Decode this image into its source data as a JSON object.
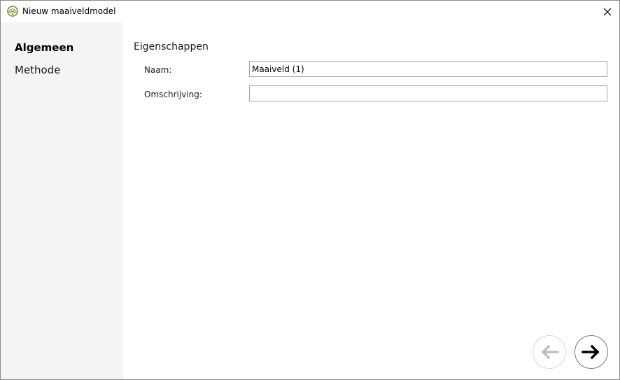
{
  "window": {
    "title": "Nieuw maaiveldmodel"
  },
  "sidebar": {
    "items": [
      {
        "label": "Algemeen",
        "active": true
      },
      {
        "label": "Methode",
        "active": false
      }
    ]
  },
  "main": {
    "section_title": "Eigenschappen",
    "fields": [
      {
        "label": "Naam:",
        "value": "Maaiveld (1)",
        "placeholder": ""
      },
      {
        "label": "Omschrijving:",
        "value": "",
        "placeholder": ""
      }
    ]
  },
  "navigation": {
    "back_icon": "arrow-left-icon",
    "next_icon": "arrow-right-icon",
    "back_enabled": false,
    "next_enabled": true
  },
  "icons": {
    "app": "app-logo-icon",
    "close": "close-icon"
  },
  "colors": {
    "sidebar_bg": "#f4f4f4",
    "accent_green": "#7a9a3a",
    "disabled_gray": "#bdbdbd"
  }
}
